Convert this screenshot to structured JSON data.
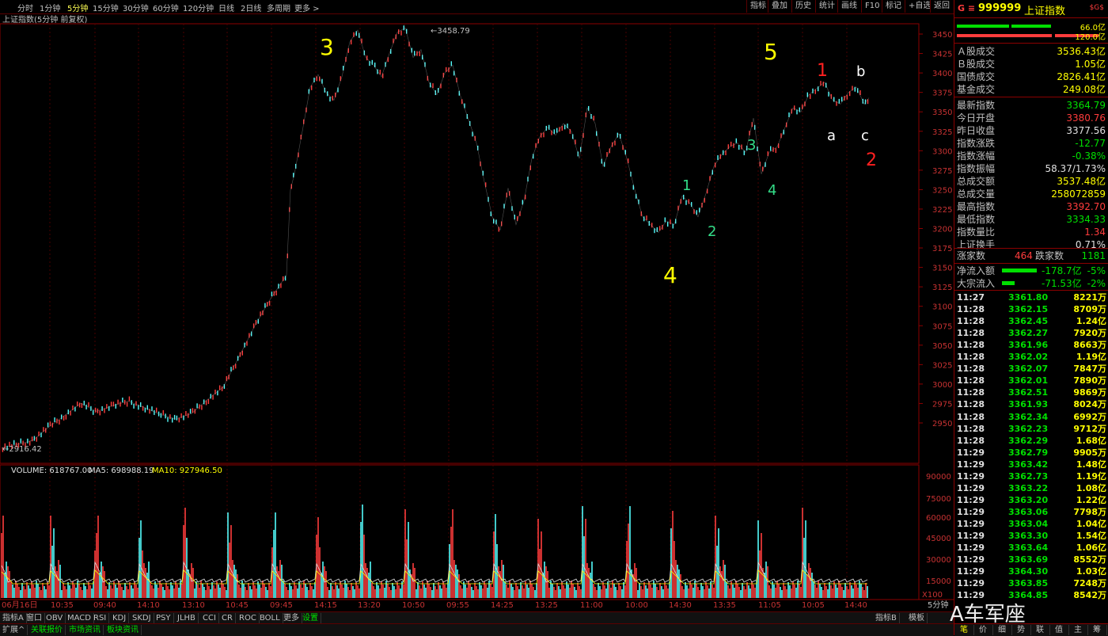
{
  "toolbar": {
    "timeframes": [
      "分时",
      "1分钟",
      "5分钟",
      "15分钟",
      "30分钟",
      "60分钟",
      "120分钟",
      "日线",
      "2日线",
      "多周期",
      "更多 >"
    ],
    "active_timeframe": "5分钟",
    "buttons": [
      "指标",
      "叠加",
      "历史",
      "统计",
      "画线",
      "F10",
      "标记",
      "+自选",
      "返回"
    ]
  },
  "chart": {
    "title": "上证指数(5分钟 前复权)",
    "high_label": "3458.79",
    "low_label": "2916.42",
    "price_axis": [
      "3450",
      "3425",
      "3400",
      "3375",
      "3350",
      "3325",
      "3300",
      "3275",
      "3250",
      "3225",
      "3200",
      "3175",
      "3150",
      "3125",
      "3100",
      "3075",
      "3050",
      "3025",
      "3000",
      "2975",
      "2950"
    ],
    "wave_labels": [
      {
        "text": "3",
        "color": "#ffff00"
      },
      {
        "text": "5",
        "color": "#ffff00"
      },
      {
        "text": "4",
        "color": "#ffff00"
      },
      {
        "text": "1",
        "color": "#ff2020"
      },
      {
        "text": "2",
        "color": "#ff2020"
      },
      {
        "text": "b",
        "color": "#ffffff"
      },
      {
        "text": "a",
        "color": "#ffffff"
      },
      {
        "text": "c",
        "color": "#ffffff"
      },
      {
        "text": "1",
        "color": "#33dd88"
      },
      {
        "text": "2",
        "color": "#33dd88"
      },
      {
        "text": "3",
        "color": "#33dd88"
      },
      {
        "text": "4",
        "color": "#33dd88"
      }
    ],
    "volume_header": {
      "volume": "VOLUME: 618767.00",
      "ma5": "MA5: 698988.19",
      "ma10": "MA10: 927946.50"
    },
    "volume_axis": [
      "90000",
      "75000",
      "60000",
      "45000",
      "30000",
      "15000"
    ],
    "volume_unit": "X100",
    "time_axis": [
      "06月16日",
      "10:35",
      "09:40",
      "14:10",
      "13:10",
      "10:45",
      "09:45",
      "14:15",
      "13:20",
      "10:50",
      "09:55",
      "14:25",
      "13:25",
      "11:00",
      "10:00",
      "14:30",
      "13:35",
      "11:05",
      "10:05",
      "14:40"
    ],
    "time_axis_right": "5分钟"
  },
  "chart_data": {
    "type": "line",
    "title": "上证指数(5分钟 前复权)",
    "ylim": [
      2915,
      3465
    ],
    "x": [
      0,
      20,
      40,
      60,
      80,
      100,
      120,
      140,
      160,
      180,
      200,
      220,
      240,
      260,
      280,
      300,
      320,
      340,
      360,
      365,
      370,
      380,
      390,
      400,
      410,
      420,
      430,
      440,
      450,
      460,
      470,
      480,
      490,
      500,
      510,
      520,
      530,
      540,
      550,
      560,
      570,
      580,
      590,
      600,
      610,
      620,
      630,
      640,
      650,
      660,
      670,
      680,
      690,
      700,
      710,
      720,
      730,
      740,
      750,
      760,
      770,
      780,
      790,
      800,
      810,
      820,
      830,
      840,
      850,
      860,
      870,
      880,
      890,
      900,
      910,
      920,
      930,
      940,
      950,
      960,
      970,
      980,
      990,
      1000,
      1010,
      1020,
      1030,
      1040,
      1050,
      1060,
      1070,
      1080,
      1090,
      1096
    ],
    "values": [
      2918,
      2922,
      2928,
      2945,
      2960,
      2975,
      2965,
      2972,
      2978,
      2970,
      2961,
      2955,
      2962,
      2980,
      2996,
      3035,
      3075,
      3110,
      3140,
      3250,
      3270,
      3325,
      3382,
      3398,
      3375,
      3365,
      3395,
      3440,
      3455,
      3420,
      3410,
      3395,
      3425,
      3452,
      3458,
      3420,
      3430,
      3388,
      3372,
      3400,
      3410,
      3370,
      3340,
      3310,
      3260,
      3215,
      3198,
      3252,
      3205,
      3235,
      3290,
      3318,
      3330,
      3320,
      3335,
      3325,
      3290,
      3355,
      3335,
      3280,
      3305,
      3322,
      3290,
      3250,
      3215,
      3205,
      3195,
      3210,
      3205,
      3242,
      3232,
      3215,
      3245,
      3280,
      3295,
      3305,
      3310,
      3298,
      3342,
      3270,
      3298,
      3305,
      3330,
      3355,
      3350,
      3372,
      3380,
      3388,
      3365,
      3360,
      3375,
      3382,
      3360,
      3368
    ],
    "ylabel": "",
    "annotations": [
      "3458.79",
      "2916.42"
    ]
  },
  "panel": {
    "code": "999999",
    "name": "上证指数",
    "badge": "$G$",
    "bar_vals": [
      "66.0亿",
      "120.0亿"
    ],
    "stats": [
      {
        "k": "Ａ股成交",
        "v": "3536.43亿",
        "c": "yl"
      },
      {
        "k": "Ｂ股成交",
        "v": "1.05亿",
        "c": "yl"
      },
      {
        "k": "国债成交",
        "v": "2826.41亿",
        "c": "yl"
      },
      {
        "k": "基金成交",
        "v": "249.08亿",
        "c": "yl"
      },
      {
        "k": "最新指数",
        "v": "3364.79",
        "c": "dn"
      },
      {
        "k": "今日开盘",
        "v": "3380.76",
        "c": "up"
      },
      {
        "k": "昨日收盘",
        "v": "3377.56",
        "c": "wh"
      },
      {
        "k": "指数涨跌",
        "v": "-12.77",
        "c": "dn"
      },
      {
        "k": "指数涨幅",
        "v": "-0.38%",
        "c": "dn"
      },
      {
        "k": "指数振幅",
        "v": "58.37/1.73%",
        "c": "wh"
      },
      {
        "k": "总成交额",
        "v": "3537.48亿",
        "c": "yl"
      },
      {
        "k": "总成交量",
        "v": "258072859",
        "c": "yl"
      },
      {
        "k": "最高指数",
        "v": "3392.70",
        "c": "up"
      },
      {
        "k": "最低指数",
        "v": "3334.33",
        "c": "dn"
      },
      {
        "k": "指数量比",
        "v": "1.34",
        "c": "up"
      },
      {
        "k": "上证换手",
        "v": "0.71%",
        "c": "wh"
      }
    ],
    "breadth": {
      "up_label": "涨家数",
      "up": "464",
      "down_label": "跌家数",
      "down": "1181"
    },
    "flows": [
      {
        "k": "净流入额",
        "v": "-178.7亿",
        "pct": "-5%"
      },
      {
        "k": "大宗流入",
        "v": "-71.53亿",
        "pct": "-2%"
      }
    ],
    "ticks": [
      {
        "t": "11:27",
        "p": "3361.80",
        "v": "8221万"
      },
      {
        "t": "11:28",
        "p": "3362.15",
        "v": "8709万"
      },
      {
        "t": "11:28",
        "p": "3362.45",
        "v": "1.24亿"
      },
      {
        "t": "11:28",
        "p": "3362.27",
        "v": "7920万"
      },
      {
        "t": "11:28",
        "p": "3361.96",
        "v": "8663万"
      },
      {
        "t": "11:28",
        "p": "3362.02",
        "v": "1.19亿"
      },
      {
        "t": "11:28",
        "p": "3362.07",
        "v": "7847万"
      },
      {
        "t": "11:28",
        "p": "3362.01",
        "v": "7890万"
      },
      {
        "t": "11:28",
        "p": "3362.51",
        "v": "9869万"
      },
      {
        "t": "11:28",
        "p": "3361.93",
        "v": "8024万"
      },
      {
        "t": "11:28",
        "p": "3362.34",
        "v": "6992万"
      },
      {
        "t": "11:28",
        "p": "3362.23",
        "v": "9712万"
      },
      {
        "t": "11:28",
        "p": "3362.29",
        "v": "1.68亿"
      },
      {
        "t": "11:29",
        "p": "3362.79",
        "v": "9905万"
      },
      {
        "t": "11:29",
        "p": "3363.42",
        "v": "1.48亿"
      },
      {
        "t": "11:29",
        "p": "3362.73",
        "v": "1.19亿"
      },
      {
        "t": "11:29",
        "p": "3363.22",
        "v": "1.08亿"
      },
      {
        "t": "11:29",
        "p": "3363.20",
        "v": "1.22亿"
      },
      {
        "t": "11:29",
        "p": "3363.06",
        "v": "7798万"
      },
      {
        "t": "11:29",
        "p": "3363.04",
        "v": "1.04亿"
      },
      {
        "t": "11:29",
        "p": "3363.30",
        "v": "1.54亿"
      },
      {
        "t": "11:29",
        "p": "3363.64",
        "v": "1.06亿"
      },
      {
        "t": "11:29",
        "p": "3363.69",
        "v": "8552万"
      },
      {
        "t": "11:29",
        "p": "3364.30",
        "v": "1.03亿"
      },
      {
        "t": "11:29",
        "p": "3363.85",
        "v": "7248万"
      },
      {
        "t": "11:29",
        "p": "3364.85",
        "v": "8542万"
      }
    ],
    "bottom_tabs": [
      "笔",
      "价",
      "细",
      "势",
      "联",
      "值",
      "主",
      "筹"
    ]
  },
  "bottom": {
    "tabs1": [
      "指标A",
      "窗口",
      "OBV",
      "MACD",
      "RSI",
      "KDJ",
      "SKDJ",
      "PSY",
      "JLHB",
      "CCI",
      "CR",
      "ROC",
      "BOLL",
      "更多",
      "设置"
    ],
    "tabs1_right": [
      "指标B",
      "模板"
    ],
    "tabs2": [
      "扩展^",
      "关联报价",
      "市场资讯",
      "板块资讯"
    ]
  },
  "watermark": "A车军座"
}
